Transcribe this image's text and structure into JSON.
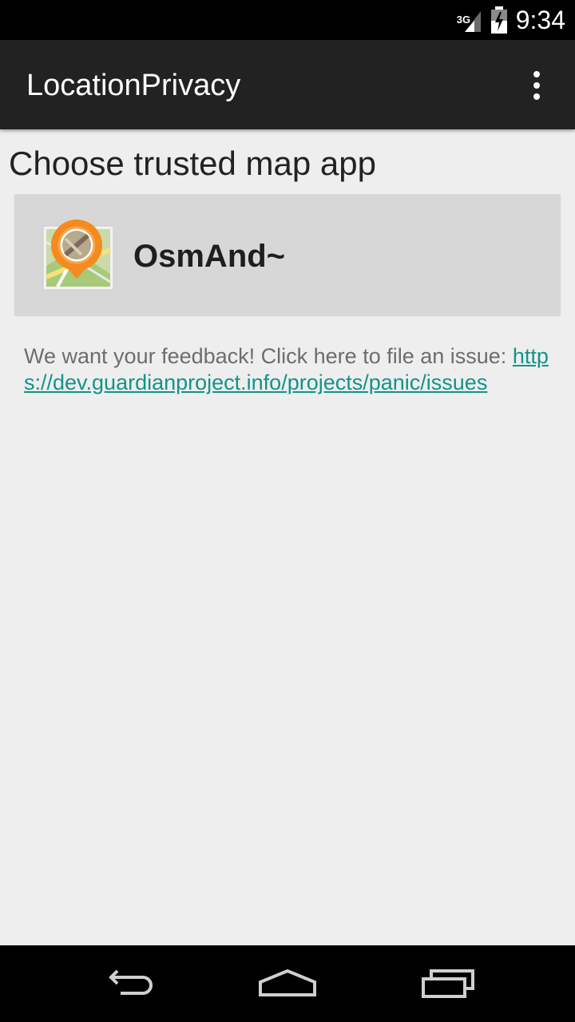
{
  "status_bar": {
    "network": "3G",
    "time": "9:34"
  },
  "action_bar": {
    "title": "LocationPrivacy",
    "overflow_icon": "more-vert-icon"
  },
  "main": {
    "section_title": "Choose trusted map app",
    "apps": [
      {
        "name": "OsmAnd~",
        "icon": "osmand-app-icon"
      }
    ],
    "feedback_text": "We want your feedback! Click here to file an issue: ",
    "feedback_link": "https://dev.guardianproject.info/projects/panic/issues"
  },
  "nav_bar": {
    "back_icon": "back-icon",
    "home_icon": "home-icon",
    "recents_icon": "recents-icon"
  },
  "colors": {
    "action_bar": "#222222",
    "background": "#eeeeee",
    "list_item": "#d7d7d7",
    "link": "#12948a",
    "osmand_orange": "#f58a1f"
  }
}
